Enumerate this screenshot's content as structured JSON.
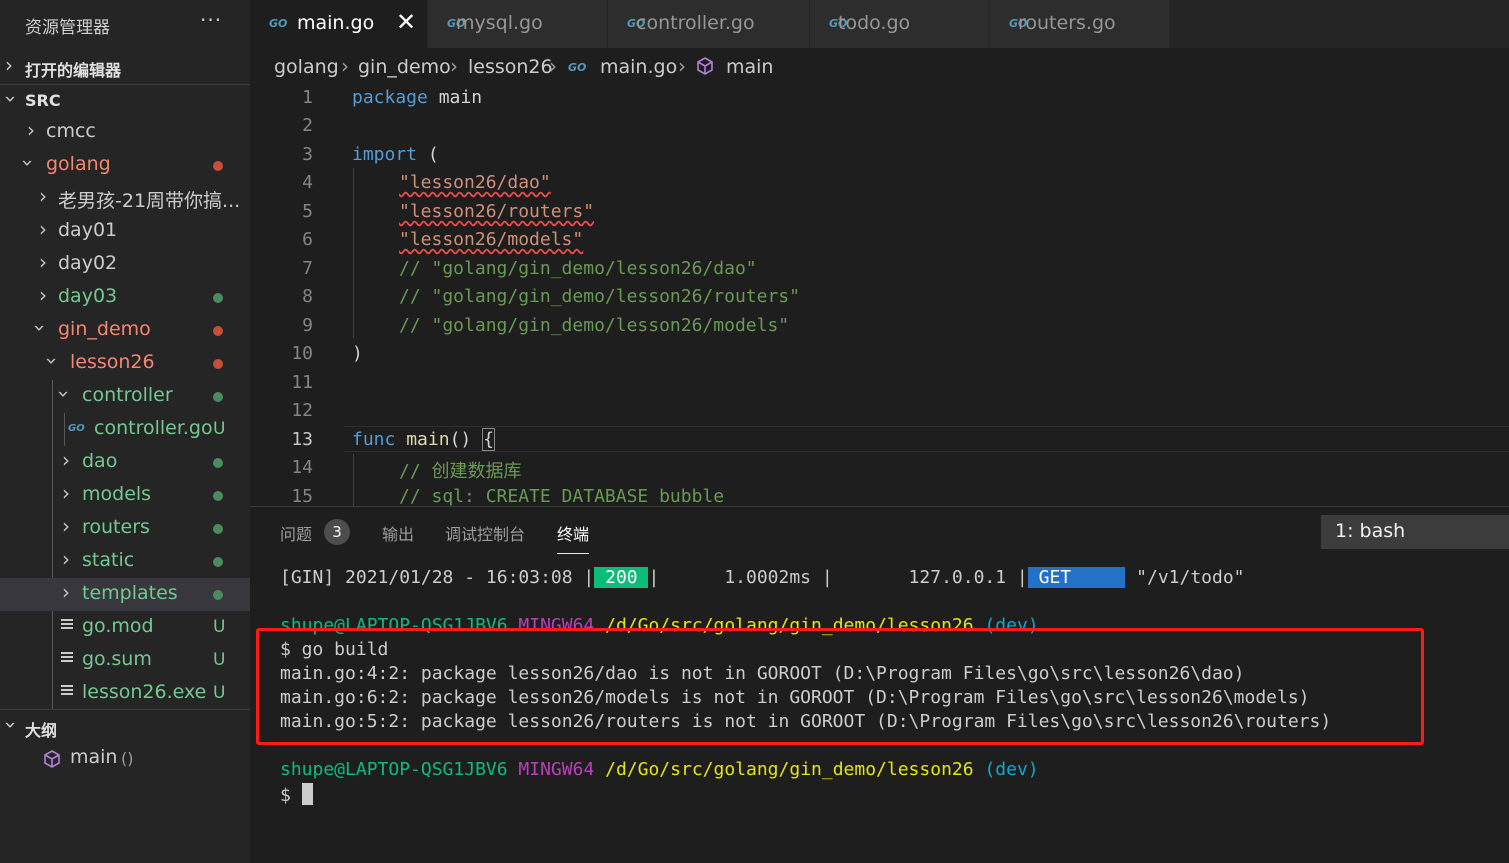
{
  "sidebar": {
    "title": "资源管理器",
    "more": "···",
    "open_editors": "打开的编辑器",
    "src": "SRC",
    "tree": [
      {
        "label": "cmcc",
        "color": "#cccccc",
        "indicator": ""
      },
      {
        "label": "golang",
        "color": "#f48771",
        "indicator": "dot",
        "dot_color": "#c74e39"
      },
      {
        "label": "老男孩-21周带你搞...",
        "color": "#cccccc",
        "indicator": ""
      },
      {
        "label": "day01",
        "color": "#cccccc",
        "indicator": ""
      },
      {
        "label": "day02",
        "color": "#cccccc",
        "indicator": ""
      },
      {
        "label": "day03",
        "color": "#73c991",
        "indicator": "dot",
        "dot_color": "#4b8c5f"
      },
      {
        "label": "gin_demo",
        "color": "#f48771",
        "indicator": "dot",
        "dot_color": "#c74e39"
      },
      {
        "label": "lesson26",
        "color": "#f48771",
        "indicator": "dot",
        "dot_color": "#c74e39"
      },
      {
        "label": "controller",
        "color": "#73c991",
        "indicator": "dot",
        "dot_color": "#4b8c5f"
      },
      {
        "label": "controller.go",
        "color": "#73c991",
        "indicator": "U",
        "go_icon": "GO"
      },
      {
        "label": "dao",
        "color": "#73c991",
        "indicator": "dot",
        "dot_color": "#4b8c5f"
      },
      {
        "label": "models",
        "color": "#73c991",
        "indicator": "dot",
        "dot_color": "#4b8c5f"
      },
      {
        "label": "routers",
        "color": "#73c991",
        "indicator": "dot",
        "dot_color": "#4b8c5f"
      },
      {
        "label": "static",
        "color": "#73c991",
        "indicator": "dot",
        "dot_color": "#4b8c5f"
      },
      {
        "label": "templates",
        "color": "#73c991",
        "indicator": "dot",
        "dot_color": "#4b8c5f"
      },
      {
        "label": "go.mod",
        "color": "#73c991",
        "indicator": "U"
      },
      {
        "label": "go.sum",
        "color": "#73c991",
        "indicator": "U"
      },
      {
        "label": "lesson26.exe",
        "color": "#73c991",
        "indicator": "U"
      }
    ],
    "outline": "大纲",
    "outline_item": {
      "label": "main",
      "detail": "()"
    }
  },
  "tabs": [
    {
      "label": "main.go",
      "icon": "GO",
      "active": true,
      "close": "✕"
    },
    {
      "label": "mysql.go",
      "icon": "GO"
    },
    {
      "label": "controller.go",
      "icon": "GO"
    },
    {
      "label": "todo.go",
      "icon": "GO"
    },
    {
      "label": "routers.go",
      "icon": "GO"
    }
  ],
  "breadcrumb": {
    "p1": "golang",
    "p2": "gin_demo",
    "p3": "lesson26",
    "go_icon": "GO",
    "p4": "main.go",
    "p5": "main",
    "sep": "›"
  },
  "editor": {
    "line_numbers": [
      "1",
      "2",
      "3",
      "4",
      "5",
      "6",
      "7",
      "8",
      "9",
      "10",
      "11",
      "12",
      "13",
      "14",
      "15"
    ],
    "code": {
      "l1_kw": "package",
      "l1_rest": " main",
      "l3_kw": "import",
      "l3_rest": " (",
      "l4": "\"lesson26/dao\"",
      "l5": "\"lesson26/routers\"",
      "l6": "\"lesson26/models\"",
      "l7": "// \"golang/gin_demo/lesson26/dao\"",
      "l8": "// \"golang/gin_demo/lesson26/routers\"",
      "l9": "// \"golang/gin_demo/lesson26/models\"",
      "l10": ")",
      "l13_kw": "func",
      "l13_fn": "main",
      "l13_paren": "() ",
      "l13_brace": "{",
      "l14": "// 创建数据库",
      "l15": "// sql: CREATE DATABASE bubble"
    }
  },
  "panel": {
    "tabs": {
      "problems": "问题",
      "problems_count": "3",
      "output": "输出",
      "debug": "调试控制台",
      "terminal": "终端"
    },
    "terminal_select": "1: bash",
    "terminal": {
      "gin_prefix": "[GIN] 2021/01/28 - 16:03:08 |",
      "gin_status": " 200 ",
      "gin_mid": "|      1.0002ms |       127.0.0.1 |",
      "gin_method": " GET     ",
      "gin_path": " \"/v1/todo\"",
      "prompt_user": "shupe@LAPTOP-QSG1JBV6",
      "prompt_env": "MINGW64",
      "prompt_path": "/d/Go/src/golang/gin_demo/lesson26",
      "prompt_branch": "(dev)",
      "cmd": "$ go build",
      "err1": "main.go:4:2: package lesson26/dao is not in GOROOT (D:\\Program Files\\go\\src\\lesson26\\dao)",
      "err2": "main.go:6:2: package lesson26/models is not in GOROOT (D:\\Program Files\\go\\src\\lesson26\\models)",
      "err3": "main.go:5:2: package lesson26/routers is not in GOROOT (D:\\Program Files\\go\\src\\lesson26\\routers)",
      "final_prompt": "$ "
    }
  },
  "colors": {
    "accent": "#007acc",
    "highlight_box": "#ff1a1a"
  }
}
